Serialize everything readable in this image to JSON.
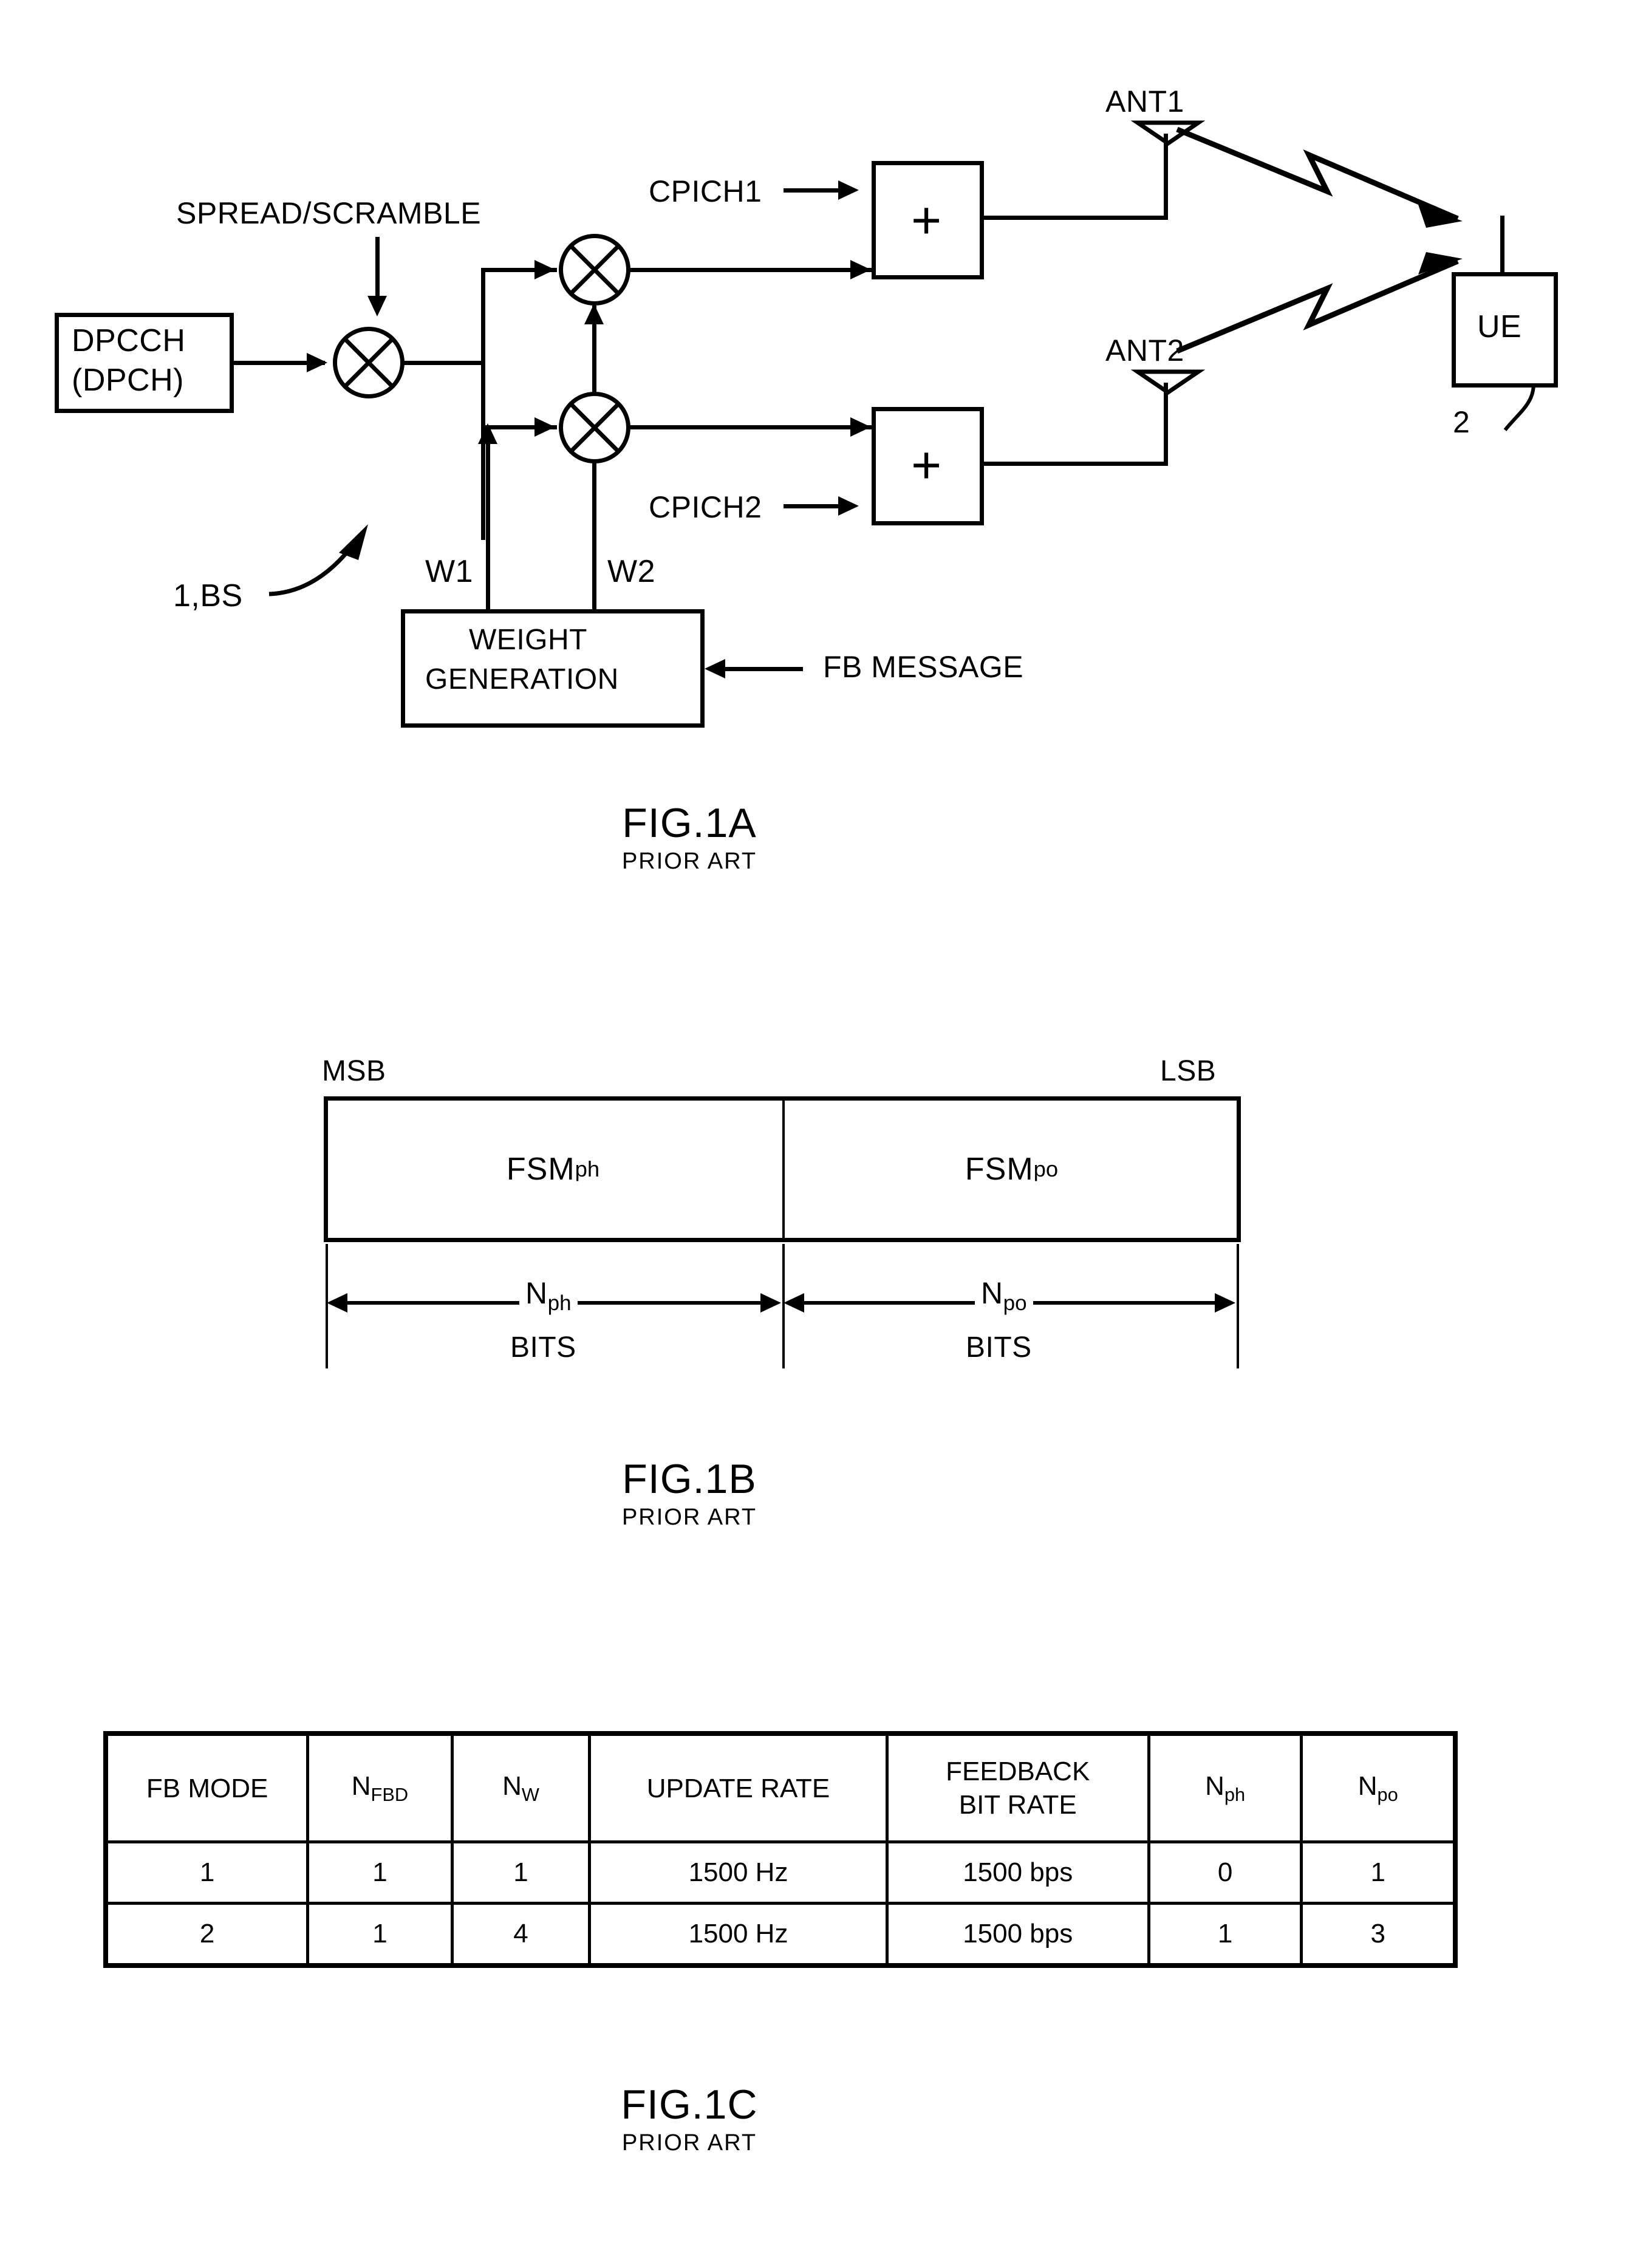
{
  "figures": [
    {
      "id": "fig1a",
      "caption": "FIG.1A",
      "subcaption": "PRIOR ART",
      "labels": {
        "source_block_line1": "DPCCH",
        "source_block_line2": "(DPCH)",
        "spread_scramble": "SPREAD/SCRAMBLE",
        "cpich1": "CPICH1",
        "cpich2": "CPICH2",
        "adder_symbol": "+",
        "ant1": "ANT1",
        "ant2": "ANT2",
        "ue": "UE",
        "ue_ref": "2",
        "bs_ref": "1,BS",
        "w1": "W1",
        "w2": "W2",
        "weight_gen_line1": "WEIGHT",
        "weight_gen_line2": "GENERATION",
        "fb_message": "FB  MESSAGE"
      }
    },
    {
      "id": "fig1b",
      "caption": "FIG.1B",
      "subcaption": "PRIOR ART",
      "labels": {
        "msb": "MSB",
        "lsb": "LSB",
        "field_left": "FSM",
        "field_left_sub": "ph",
        "field_right": "FSM",
        "field_right_sub": "po",
        "dim_left": "N",
        "dim_left_sub": "ph",
        "dim_left_unit": "BITS",
        "dim_right": "N",
        "dim_right_sub": "po",
        "dim_right_unit": "BITS"
      }
    },
    {
      "id": "fig1c",
      "caption": "FIG.1C",
      "subcaption": "PRIOR ART",
      "table": {
        "headers": [
          {
            "text": "FB MODE",
            "sub": "",
            "line2": ""
          },
          {
            "text": "N",
            "sub": "FBD",
            "line2": ""
          },
          {
            "text": "N",
            "sub": "W",
            "line2": ""
          },
          {
            "text": "UPDATE  RATE",
            "sub": "",
            "line2": ""
          },
          {
            "text": "FEEDBACK",
            "sub": "",
            "line2": "BIT RATE"
          },
          {
            "text": "N",
            "sub": "ph",
            "line2": ""
          },
          {
            "text": "N",
            "sub": "po",
            "line2": ""
          }
        ],
        "rows": [
          [
            "1",
            "1",
            "1",
            "1500  Hz",
            "1500  bps",
            "0",
            "1"
          ],
          [
            "2",
            "1",
            "4",
            "1500  Hz",
            "1500  bps",
            "1",
            "3"
          ]
        ]
      }
    }
  ]
}
